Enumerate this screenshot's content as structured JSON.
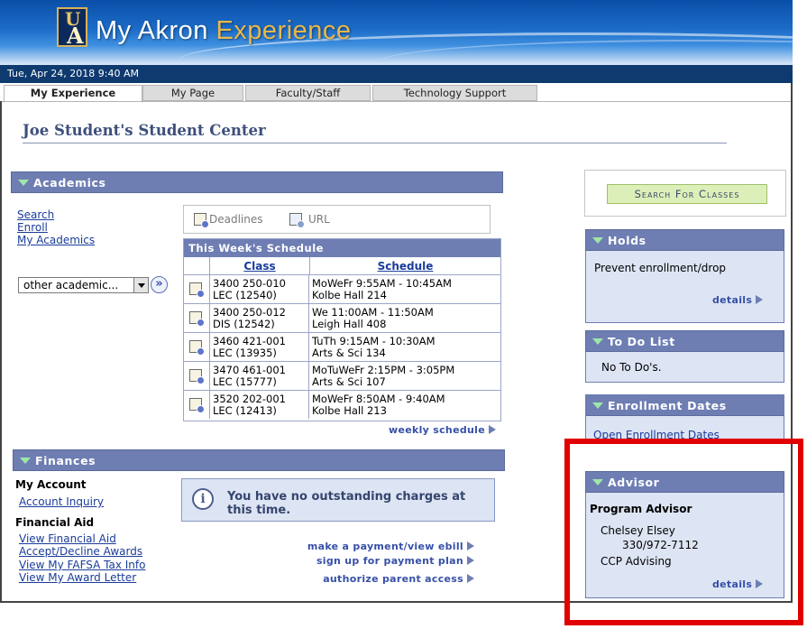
{
  "header": {
    "logo_u": "U",
    "logo_a": "A",
    "title_part1": "My Akron",
    "title_part2": "Experience",
    "datetime": "Tue, Apr 24, 2018 9:40 AM"
  },
  "tabs": [
    {
      "label": "My Experience",
      "active": true
    },
    {
      "label": "My Page",
      "active": false
    },
    {
      "label": "Faculty/Staff",
      "active": false
    },
    {
      "label": "Technology Support",
      "active": false
    }
  ],
  "page_title": "Joe Student's  Student Center",
  "academics": {
    "header": "Academics",
    "links": [
      "Search",
      "Enroll",
      "My Academics"
    ],
    "select_value": "other academic...",
    "go_icon": "double-chevron-right-icon",
    "deadlines_label": "Deadlines",
    "url_label": "URL",
    "schedule": {
      "title": "This Week's Schedule",
      "col_class": "Class",
      "col_schedule": "Schedule",
      "rows": [
        {
          "class1": "3400 250-010",
          "class2": "LEC (12540)",
          "sched1": "MoWeFr 9:55AM - 10:45AM",
          "sched2": "Kolbe Hall 214"
        },
        {
          "class1": "3400 250-012",
          "class2": "DIS (12542)",
          "sched1": "We 11:00AM - 11:50AM",
          "sched2": "Leigh Hall 408"
        },
        {
          "class1": "3460 421-001",
          "class2": "LEC (13935)",
          "sched1": "TuTh 9:15AM - 10:30AM",
          "sched2": "Arts & Sci 134"
        },
        {
          "class1": "3470 461-001",
          "class2": "LEC (15777)",
          "sched1": "MoTuWeFr 2:15PM - 3:05PM",
          "sched2": "Arts & Sci 107"
        },
        {
          "class1": "3520 202-001",
          "class2": "LEC (12413)",
          "sched1": "MoWeFr 8:50AM - 9:40AM",
          "sched2": "Kolbe Hall 213"
        }
      ],
      "weekly_link": "weekly schedule"
    }
  },
  "finances": {
    "header": "Finances",
    "my_account_label": "My Account",
    "account_inquiry": "Account Inquiry",
    "financial_aid_label": "Financial Aid",
    "aid_links": [
      "View Financial Aid",
      "Accept/Decline Awards",
      "View My FAFSA Tax Info",
      "View My Award Letter"
    ],
    "charges_msg": "You have no outstanding charges at this time.",
    "actions": [
      "make a payment/view ebill",
      "sign up for payment plan",
      "authorize parent access"
    ]
  },
  "right": {
    "search_button": "Search For Classes",
    "holds": {
      "header": "Holds",
      "text": "Prevent enrollment/drop",
      "details": "details"
    },
    "todo": {
      "header": "To Do List",
      "text": "No To Do's."
    },
    "enrollment": {
      "header": "Enrollment Dates",
      "link": "Open Enrollment Dates"
    },
    "advisor": {
      "header": "Advisor",
      "program_label": "Program Advisor",
      "name": "Chelsey Elsey",
      "phone": "330/972-7112",
      "dept": "CCP Advising",
      "details": "details"
    }
  },
  "colors": {
    "section_header": "#6e7eb3",
    "pagelet_bg": "#dde4f3",
    "link": "#1a3c9a",
    "highlight": "#e00000"
  }
}
